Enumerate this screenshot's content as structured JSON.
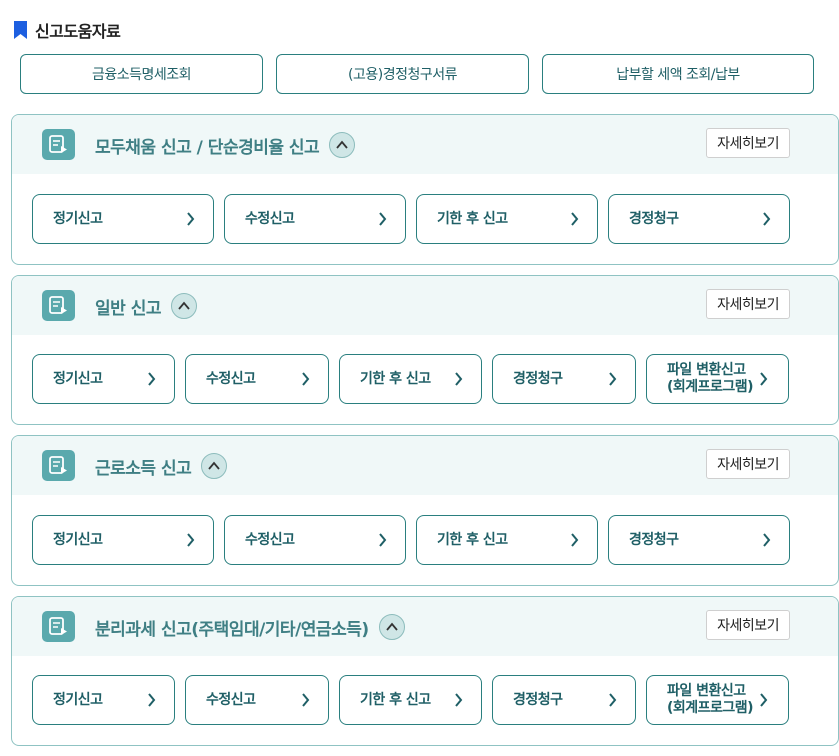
{
  "header": {
    "title": "신고도움자료",
    "icon": "bookmark-icon",
    "icon_color": "#1d5fe0"
  },
  "top_buttons": [
    "금융소득명세조회",
    "(고용)경정청구서류",
    "납부할 세액 조회/납부"
  ],
  "panels": [
    {
      "title": "모두채움 신고 / 단순경비율 신고",
      "detail": "자세히보기",
      "actions": [
        "정기신고",
        "수정신고",
        "기한 후 신고",
        "경정청구"
      ]
    },
    {
      "title": "일반 신고",
      "detail": "자세히보기",
      "actions": [
        "정기신고",
        "수정신고",
        "기한 후 신고",
        "경정청구",
        "파일 변환신고",
        "(회계프로그램)"
      ]
    },
    {
      "title": "근로소득 신고",
      "detail": "자세히보기",
      "actions": [
        "정기신고",
        "수정신고",
        "기한 후 신고",
        "경정청구"
      ]
    },
    {
      "title": "분리과세 신고(주택임대/기타/연금소득)",
      "detail": "자세히보기",
      "actions": [
        "정기신고",
        "수정신고",
        "기한 후 신고",
        "경정청구",
        "파일 변환신고",
        "(회계프로그램)"
      ]
    }
  ],
  "colors": {
    "accent": "#2a7f7f",
    "panel_bg": "#f0f8f8",
    "icon_bg": "#5aa9ad",
    "title": "#3f7f84"
  }
}
